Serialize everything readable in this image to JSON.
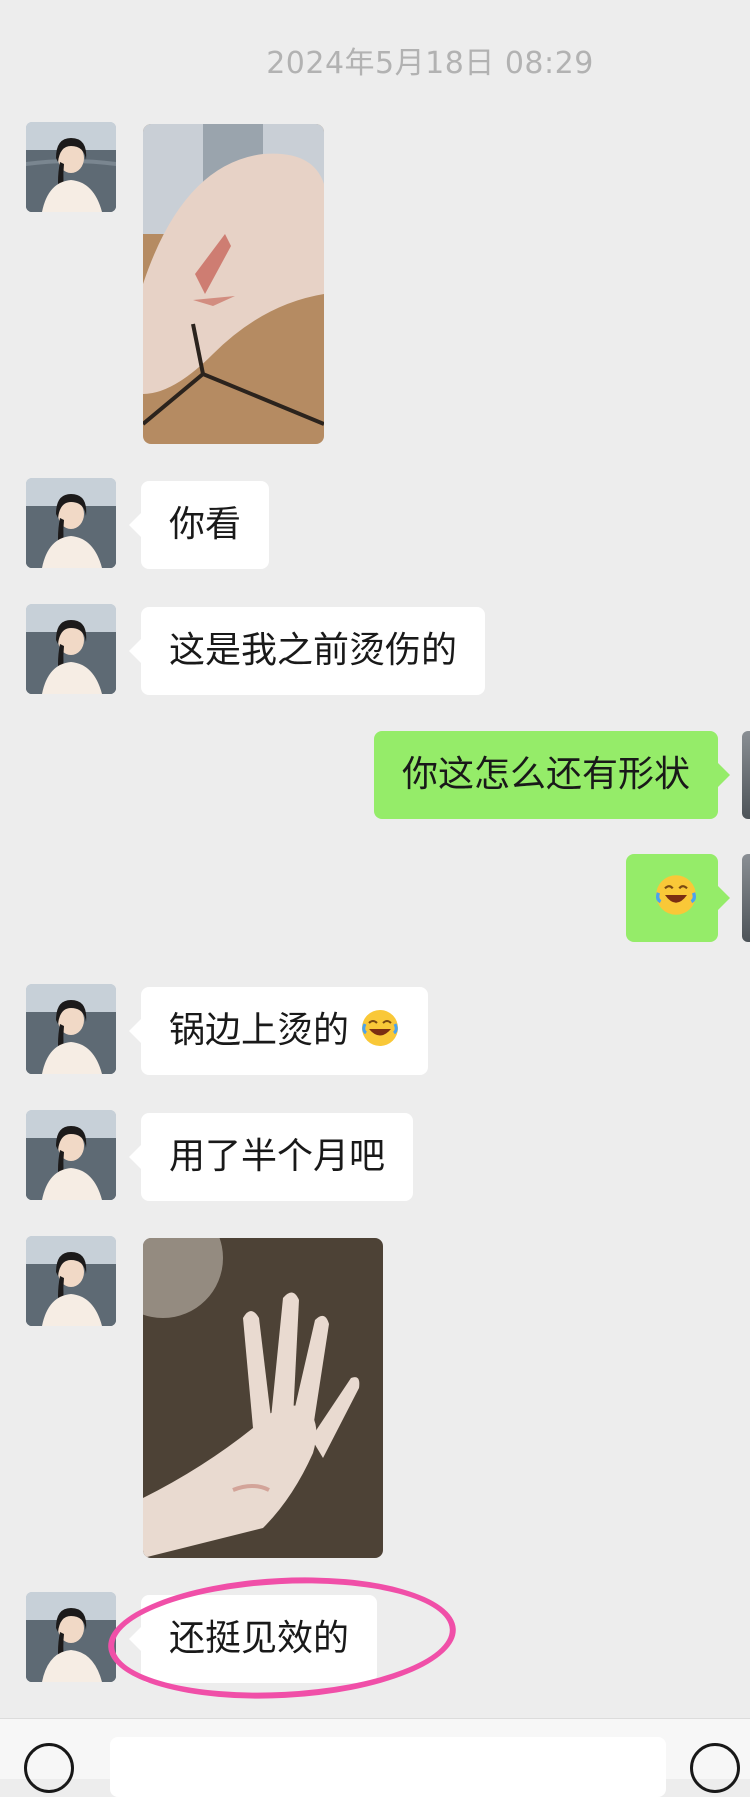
{
  "chat": {
    "timestamp": "2024年5月18日 08:29",
    "messages": [
      {
        "side": "left",
        "type": "image",
        "content": "hand-burn-photo"
      },
      {
        "side": "left",
        "type": "text",
        "text": "你看"
      },
      {
        "side": "left",
        "type": "text",
        "text": "这是我之前烫伤的"
      },
      {
        "side": "right",
        "type": "text",
        "text": "你这怎么还有形状"
      },
      {
        "side": "right",
        "type": "emoji",
        "content": "laughing-crying-emoji"
      },
      {
        "side": "left",
        "type": "text",
        "text": "锅边上烫的",
        "emoji": "laughing-tears-emoji"
      },
      {
        "side": "left",
        "type": "text",
        "text": "用了半个月吧"
      },
      {
        "side": "left",
        "type": "image",
        "content": "healed-hand-photo"
      },
      {
        "side": "left",
        "type": "text",
        "text": "还挺见效的",
        "highlighted": true
      }
    ]
  },
  "colors": {
    "background": "#ededed",
    "incoming_bubble": "#ffffff",
    "outgoing_bubble": "#95ec69",
    "timestamp_text": "#b2b2b2",
    "highlight": "#f04fa8"
  },
  "icons": {
    "voice": "voice-icon",
    "more": "plus-icon"
  }
}
